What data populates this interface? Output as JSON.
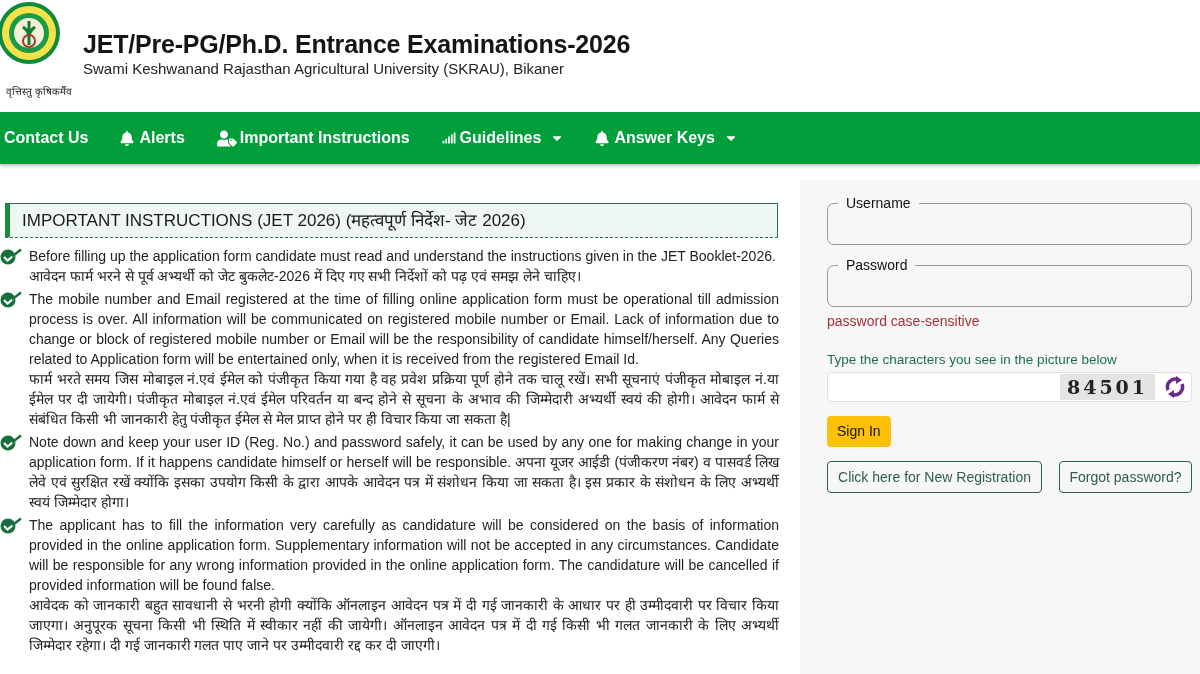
{
  "header": {
    "motto": "वृत्तिस्तु कृषिकर्मैव",
    "title": "JET/Pre-PG/Ph.D. Entrance Examinations-2026",
    "subtitle": "Swami Keshwanand Rajasthan Agricultural University (SKRAU), Bikaner"
  },
  "nav": [
    {
      "label": "Contact Us",
      "kind": "plain",
      "dropdown": false
    },
    {
      "label": "Alerts",
      "kind": "bell",
      "dropdown": false
    },
    {
      "label": "Important Instructions",
      "kind": "user",
      "dropdown": false
    },
    {
      "label": "Guidelines",
      "kind": "chart",
      "dropdown": true
    },
    {
      "label": "Answer Keys",
      "kind": "bell",
      "dropdown": true
    }
  ],
  "instructions": {
    "heading": "IMPORTANT INSTRUCTIONS (JET 2026) (महत्वपूर्ण निर्देश- जेट 2026)",
    "items": [
      {
        "paragraphs": [
          "Before filling up the application form candidate must read and understand the instructions given in the JET Booklet-2026.",
          "आवेदन फार्म भरने से पूर्व अभ्यर्थी को जेट बुकलेट-2026 में दिए गए सभी निर्देशों को पढ़ एवं समझ लेने चाहिए।"
        ]
      },
      {
        "paragraphs": [
          "The mobile number and Email registered at the time of filling online application form must be operational till admission process is over. All information will be communicated on registered mobile number or Email. Lack of information due to change or block of registered mobile number or Email will be the responsibility of candidate himself/herself. Any Queries related to Application form will be entertained only, when it is received from the registered Email Id.",
          "फार्म भरते समय जिस मोबाइल नं.एवं ईमेल को पंजीकृत किया गया है वह प्रवेश प्रक्रिया पूर्ण होने तक चालू रखें। सभी सूचनाएं पंजीकृत मोबाइल नं.या ईमेल पर दी जायेगी। पंजीकृत मोबाइल नं.एवं ईमेल परिवर्तन या बन्द होने से सूचना के अभाव की जिम्मेदारी अभ्यर्थी स्वयं की होगी। आवेदन फार्म से संबंधित किसी भी जानकारी हेतु पंजीकृत ईमेल से मेल प्राप्त होने पर ही विचार किया जा सकता है|"
        ]
      },
      {
        "paragraphs": [
          "Note down and keep your user ID (Reg. No.) and password safely, it can be used by any one for making change in your application form. If it happens candidate himself or herself will be responsible. अपना यूजर आईडी (पंजीकरण नंबर) व पासवर्ड लिख लेवे एवं सुरक्षित रखें क्योंकि इसका उपयोग किसी के द्वारा आपके आवेदन पत्र में संशोधन किया जा सकता है। इस प्रकार के संशोधन के लिए अभ्यर्थी स्वयं जिम्मेदार होगा।"
        ]
      },
      {
        "paragraphs": [
          "The applicant has to fill the information very carefully as candidature will be considered on the basis of information provided in the online application form. Supplementary information will not be accepted in any circumstances. Candidate will be responsible for any wrong information provided in the online application form. The candidature will be cancelled if provided information will be found false.",
          "आवेदक को जानकारी बहुत सावधानी से भरनी होगी क्योंकि ऑनलाइन आवेदन पत्र में दी गई जानकारी के आधार पर ही उम्मीदवारी पर विचार किया जाएगा। अनुपूरक सूचना किसी भी स्थिति में स्वीकार नहीं की जायेगी। ऑनलाइन आवेदन पत्र में दी गई किसी भी गलत जानकारी के लिए अभ्यर्थी जिम्मेदार रहेगा। दी गई जानकारी गलत पाए जाने पर उम्मीदवारी रद्द कर दी जाएगी।"
        ]
      }
    ]
  },
  "login": {
    "fields": [
      {
        "label": "Username"
      },
      {
        "label": "Password"
      }
    ],
    "password_hint": "password case-sensitive",
    "captcha": {
      "prompt": "Type the characters you see in the picture below",
      "code": "84501"
    },
    "sign_in": "Sign In",
    "links": [
      "Click here for New Registration",
      "Forgot password?"
    ]
  }
}
